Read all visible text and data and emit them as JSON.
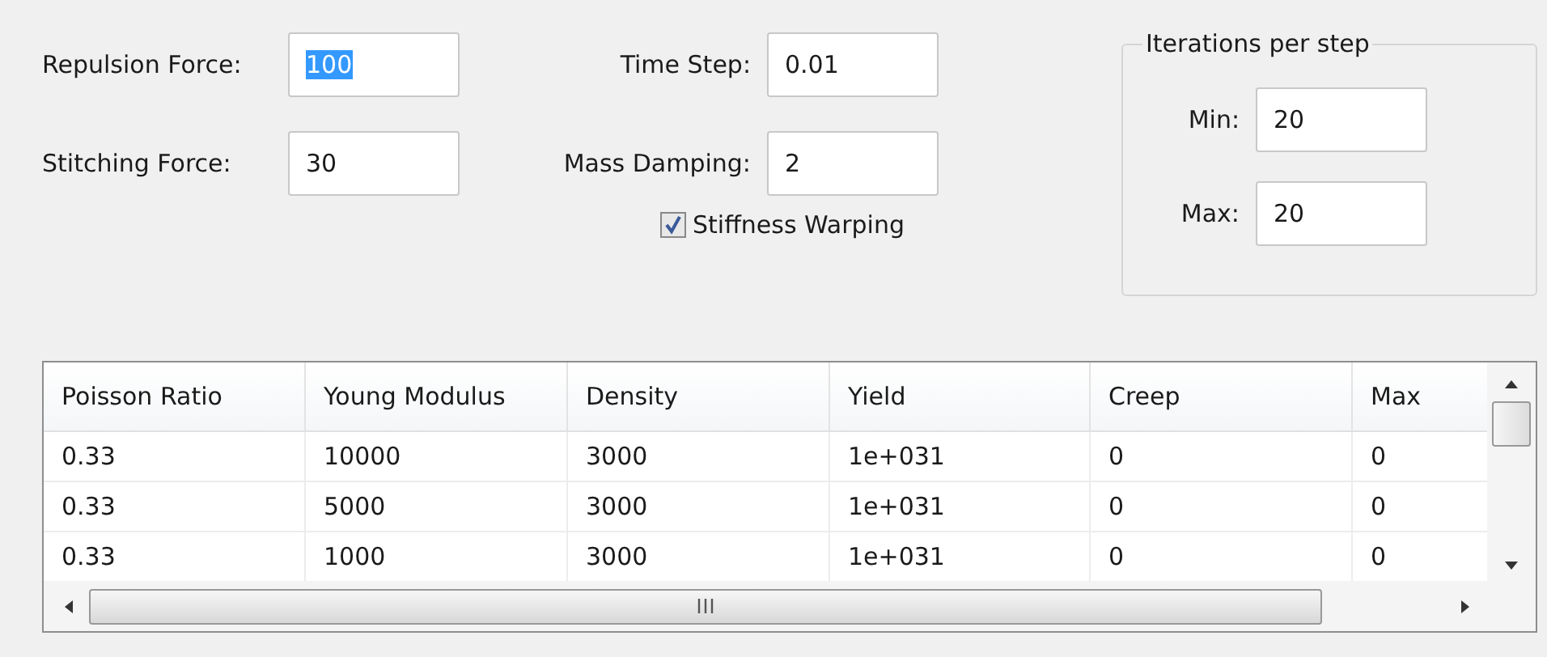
{
  "fields": [
    {
      "label": "Repulsion Force:",
      "value": "100",
      "text_selected": true
    },
    {
      "label": "Time Step:",
      "value": "0.01",
      "text_selected": false
    },
    {
      "label": "Stitching Force:",
      "value": "30",
      "text_selected": false
    },
    {
      "label": "Mass Damping:",
      "value": "2",
      "text_selected": false
    }
  ],
  "stiffness_warping": {
    "label": "Stiffness Warping",
    "checked": true
  },
  "iterations_group": {
    "title": "Iterations per step",
    "fields": [
      {
        "label": "Min:",
        "value": "20"
      },
      {
        "label": "Max:",
        "value": "20"
      }
    ]
  },
  "table": {
    "columns": [
      "Poisson Ratio",
      "Young Modulus",
      "Density",
      "Yield",
      "Creep",
      "Max"
    ],
    "rows": [
      [
        "0.33",
        "10000",
        "3000",
        "1e+031",
        "0",
        "0"
      ],
      [
        "0.33",
        "5000",
        "3000",
        "1e+031",
        "0",
        "0"
      ],
      [
        "0.33",
        "1000",
        "3000",
        "1e+031",
        "0",
        "0"
      ]
    ]
  }
}
